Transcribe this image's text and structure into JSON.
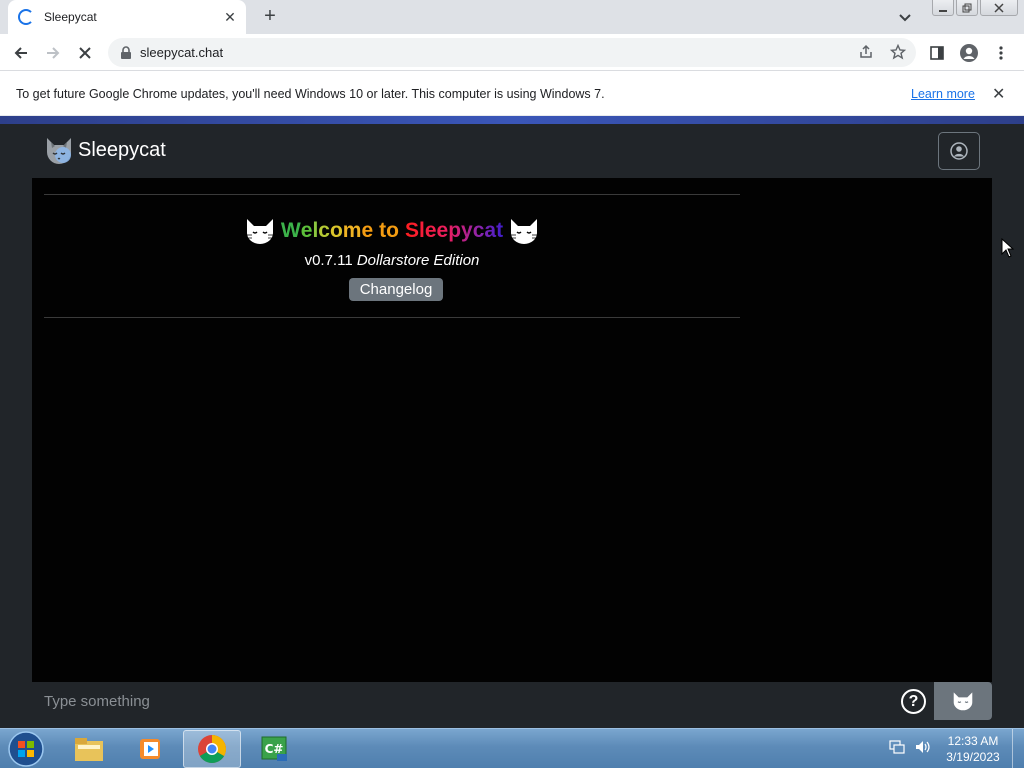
{
  "browser": {
    "tab_title": "Sleepycat",
    "url": "sleepycat.chat",
    "new_tab_symbol": "+",
    "tab_close_symbol": "✕"
  },
  "infobar": {
    "message": "To get future Google Chrome updates, you'll need Windows 10 or later. This computer is using Windows 7.",
    "learn_more": "Learn more"
  },
  "app": {
    "brand": "Sleepycat",
    "welcome": {
      "word1": "Welcome",
      "word2": "to",
      "word3": "Sleepycat",
      "version": "v0.7.11",
      "edition": "Dollarstore Edition",
      "changelog_label": "Changelog"
    },
    "input_placeholder": "Type something",
    "help_symbol": "?"
  },
  "taskbar": {
    "time": "12:33 AM",
    "date": "3/19/2023",
    "items": [
      "file-explorer",
      "media-player",
      "chrome",
      "csharp-app"
    ]
  },
  "colors": {
    "accent": "#1a73e8",
    "page_bg": "#212529",
    "chat_bg": "#020202",
    "button_gray": "#6c757d"
  }
}
